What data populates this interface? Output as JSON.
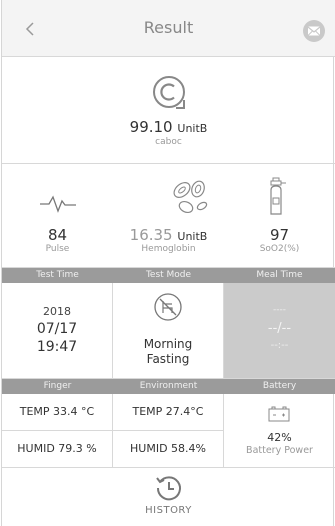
{
  "header": {
    "title": "Result",
    "back_icon": "chevron-left-icon",
    "mail_icon": "envelope-icon"
  },
  "main": {
    "value": "99.10",
    "unit": "UnitB",
    "sub": "caboc",
    "icon": "copyright-c-icon"
  },
  "metrics": [
    {
      "value": "84",
      "unit": "",
      "label": "Pulse",
      "icon": "pulse-wave-icon"
    },
    {
      "value": "16.35",
      "unit": "UnitB",
      "label": "Hemoglobin",
      "icon": "blood-cells-icon"
    },
    {
      "value": "97",
      "unit": "",
      "label": "SoO2(%)",
      "icon": "oxygen-tank-icon"
    }
  ],
  "band1": {
    "col1": "Test Time",
    "col2": "Test Mode",
    "col3": "Meal Time"
  },
  "test_time": {
    "year": "2018",
    "date": "07/17",
    "time": "19:47"
  },
  "test_mode": {
    "line1": "Morning",
    "line2": "Fasting",
    "icon": "meal-chair-icon"
  },
  "meal_time": {
    "line1": "----",
    "line2": "--/--",
    "line3": "--:--"
  },
  "band2": {
    "col1": "Finger",
    "col2": "Environment",
    "col3": "Battery"
  },
  "finger": {
    "temp": "TEMP 33.4 °C",
    "humid": "HUMID 79.3 %"
  },
  "environment": {
    "temp": "TEMP 27.4°C",
    "humid": "HUMID 58.4%"
  },
  "battery": {
    "percent": "42%",
    "label": "Battery Power",
    "icon": "battery-icon"
  },
  "history": {
    "label": "HISTORY",
    "icon": "history-clock-icon"
  },
  "colors": {
    "band": "#9b9b9b",
    "meal_bg": "#cbcbcb",
    "header_bg": "#f4f4f4"
  }
}
